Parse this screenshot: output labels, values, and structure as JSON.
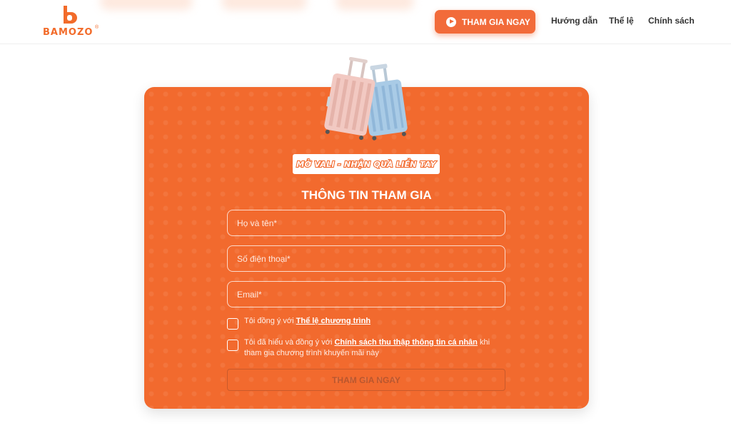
{
  "header": {
    "logo_text": "BAMOZO",
    "logo_reg": "®",
    "cta_label": "THAM GIA NGAY",
    "nav": [
      "Hướng dẫn",
      "Thể lệ",
      "Chính sách"
    ]
  },
  "card": {
    "slogan": "MỞ VALI - NHẬN QUÀ LIỀN TAY",
    "title": "THÔNG TIN THAM GIA",
    "fields": {
      "name_placeholder": "Họ và tên*",
      "phone_placeholder": "Số điện thoại*",
      "email_placeholder": "Email*"
    },
    "terms": {
      "prefix": "Tôi đồng ý với ",
      "link": "Thể lệ chương trình"
    },
    "privacy": {
      "prefix": "Tôi đã hiểu và đồng ý với ",
      "link": "Chính sách thu thập thông tin cá nhân",
      "suffix": " khi tham gia chương trình khuyến mãi này"
    },
    "submit_label": "THAM GIA NGAY"
  },
  "colors": {
    "brand": "#f26b2a",
    "card_bg": "#f26a2e",
    "text_dark": "#333333"
  },
  "icons": [
    "bamozo-logo-icon",
    "play-icon",
    "luggage-image"
  ]
}
